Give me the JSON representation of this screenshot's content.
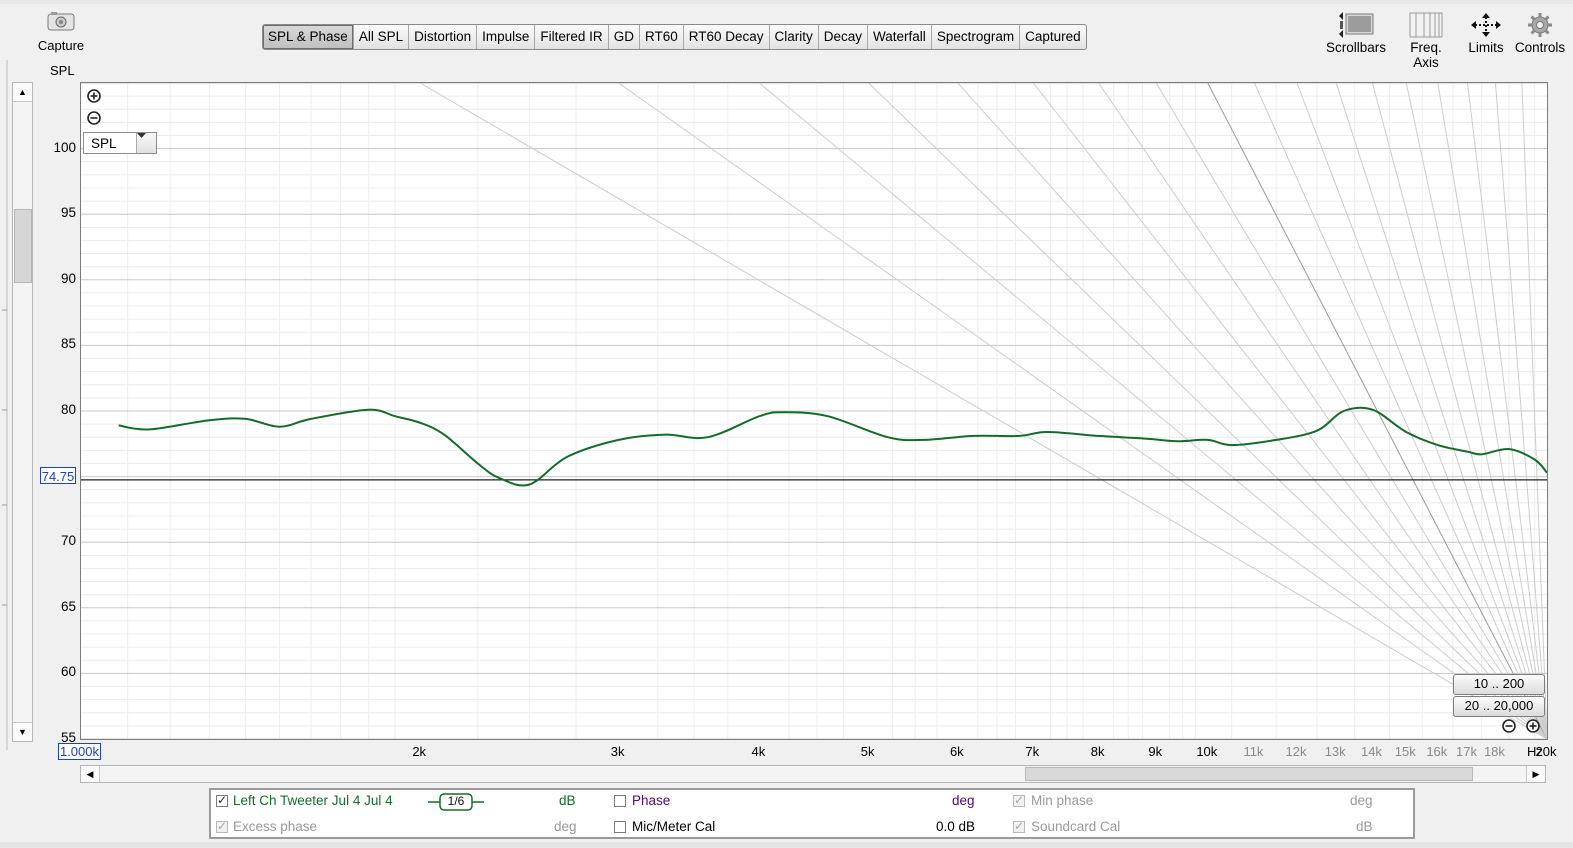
{
  "capture": {
    "label": "Capture"
  },
  "spl_title": "SPL",
  "tabs": [
    "SPL & Phase",
    "All SPL",
    "Distortion",
    "Impulse",
    "Filtered IR",
    "GD",
    "RT60",
    "RT60 Decay",
    "Clarity",
    "Decay",
    "Waterfall",
    "Spectrogram",
    "Captured"
  ],
  "active_tab": "SPL & Phase",
  "tools": {
    "scrollbars": "Scrollbars",
    "freq_axis": "Freq. Axis",
    "limits": "Limits",
    "controls": "Controls"
  },
  "y_axis": {
    "ticks": [
      "100",
      "95",
      "90",
      "85",
      "80",
      "70",
      "65",
      "60",
      "55"
    ],
    "cursor_value": "74.75"
  },
  "x_axis": {
    "start_label": "1.000k",
    "unit": "Hz",
    "ticks": [
      "2k",
      "3k",
      "4k",
      "5k",
      "6k",
      "7k",
      "8k",
      "9k",
      "10k",
      "11k",
      "12k",
      "13k",
      "14k",
      "15k",
      "16k",
      "17k",
      "18k",
      "20k"
    ]
  },
  "plot_controls": {
    "spl_select": "SPL",
    "range_1": "10 .. 200",
    "range_2": "20 .. 20,000"
  },
  "legend": {
    "trace_name": "Left Ch Tweeter Jul 4 Jul 4",
    "smoothing": "1/6",
    "unit_db": "dB",
    "phase_label": "Phase",
    "phase_unit": "deg",
    "min_phase_label": "Min phase",
    "min_phase_unit": "deg",
    "excess_phase_label": "Excess phase",
    "excess_phase_unit": "deg",
    "mic_cal_label": "Mic/Meter Cal",
    "mic_cal_value": "0.0 dB",
    "soundcard_cal_label": "Soundcard Cal",
    "soundcard_cal_unit": "dB"
  },
  "colors": {
    "trace": "#146b2c",
    "cursor_box": "#1e3fd0",
    "phase_text": "#4b0d6e"
  },
  "chart_data": {
    "type": "line",
    "x_scale": "log",
    "xlim": [
      1000,
      20000
    ],
    "ylim": [
      55,
      105
    ],
    "ylabel": "SPL",
    "xlabel": "",
    "grid": true,
    "cursor_y": 74.75,
    "series": [
      {
        "x": [
          1080,
          1150,
          1300,
          1400,
          1500,
          1600,
          1800,
          1900,
          2000,
          2100,
          2250,
          2350,
          2500,
          2700,
          3000,
          3300,
          3600,
          4000,
          4200,
          4600,
          5200,
          5600,
          6200,
          6800,
          7200,
          8000,
          8800,
          9400,
          10000,
          10500,
          11500,
          12500,
          13200,
          14000,
          15000,
          16000,
          17000,
          17500,
          18500,
          19500,
          20000
        ],
        "y": [
          78.9,
          78.6,
          79.3,
          79.4,
          78.8,
          79.4,
          80.1,
          79.6,
          79.1,
          78.2,
          76.0,
          74.9,
          74.4,
          76.5,
          77.8,
          78.2,
          78.0,
          79.6,
          79.9,
          79.6,
          78.0,
          77.8,
          78.1,
          78.1,
          78.4,
          78.1,
          77.9,
          77.7,
          77.8,
          77.4,
          77.8,
          78.5,
          80.0,
          80.1,
          78.4,
          77.4,
          76.9,
          76.7,
          77.1,
          76.3,
          75.3
        ]
      }
    ]
  }
}
